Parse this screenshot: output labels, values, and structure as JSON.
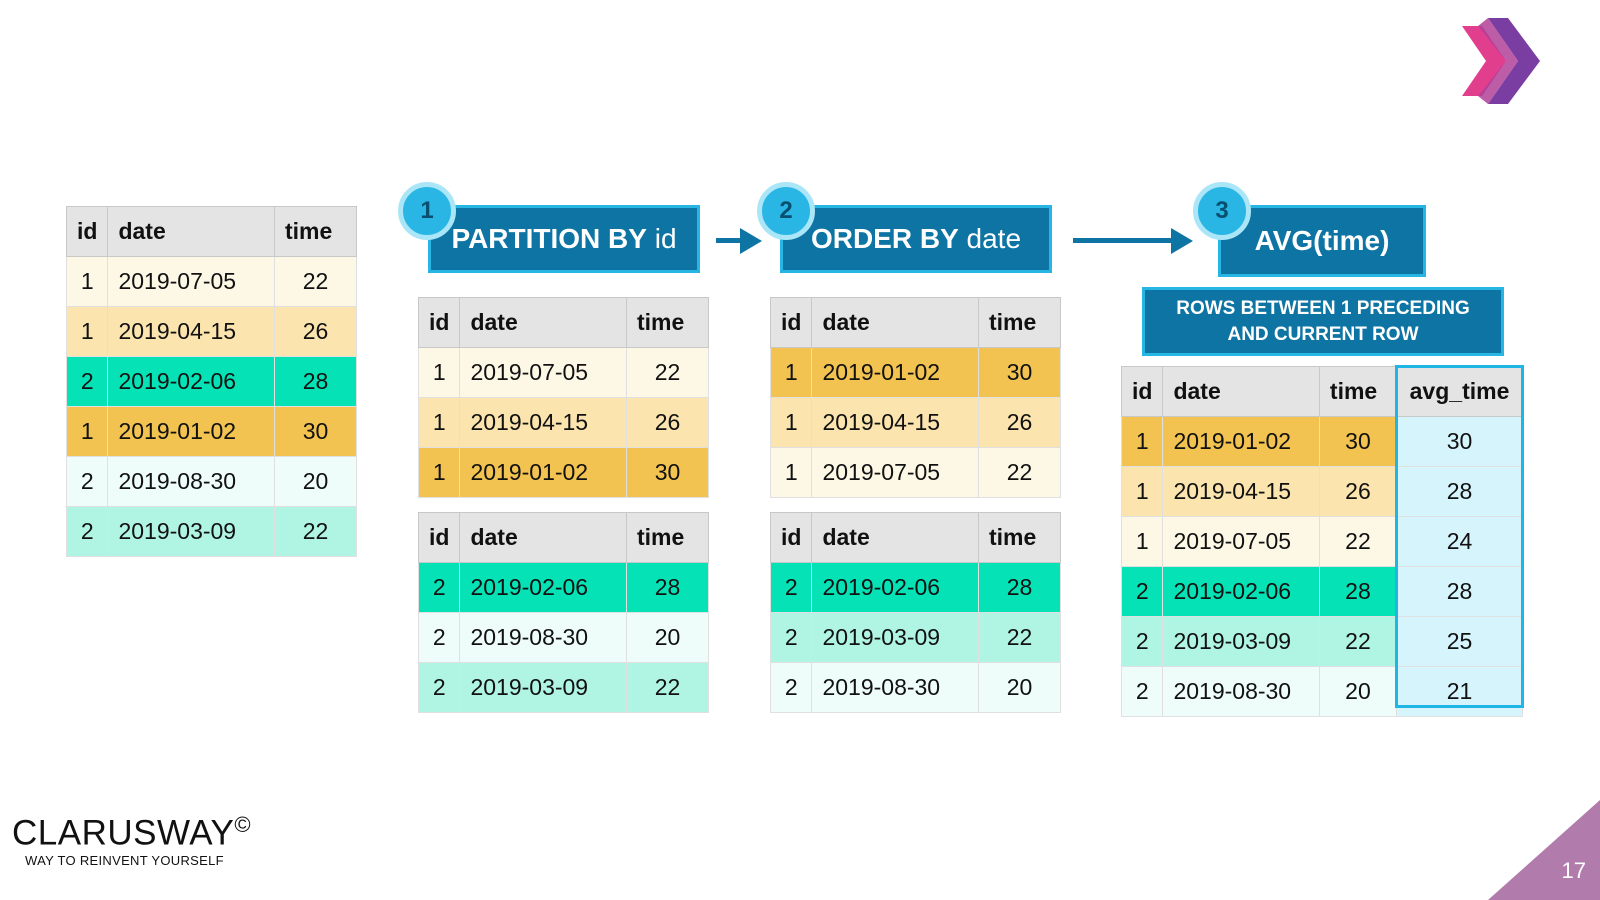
{
  "source_table": {
    "headers": [
      "id",
      "date",
      "time"
    ],
    "rows": [
      {
        "id": "1",
        "date": "2019-07-05",
        "time": "22",
        "shade": "y0"
      },
      {
        "id": "1",
        "date": "2019-04-15",
        "time": "26",
        "shade": "y1"
      },
      {
        "id": "2",
        "date": "2019-02-06",
        "time": "28",
        "shade": "g2"
      },
      {
        "id": "1",
        "date": "2019-01-02",
        "time": "30",
        "shade": "y2"
      },
      {
        "id": "2",
        "date": "2019-08-30",
        "time": "20",
        "shade": "g0"
      },
      {
        "id": "2",
        "date": "2019-03-09",
        "time": "22",
        "shade": "g1"
      }
    ]
  },
  "steps": [
    {
      "number": "1",
      "keyword": "PARTITION BY",
      "arg": "id"
    },
    {
      "number": "2",
      "keyword": "ORDER BY",
      "arg": "date"
    },
    {
      "number": "3",
      "keyword": "AVG(time)",
      "arg": ""
    }
  ],
  "frame_clause": {
    "line1": "ROWS BETWEEN 1 PRECEDING",
    "line2": "AND CURRENT ROW"
  },
  "partition_tables": [
    {
      "headers": [
        "id",
        "date",
        "time"
      ],
      "rows": [
        {
          "id": "1",
          "date": "2019-07-05",
          "time": "22",
          "shade": "y0"
        },
        {
          "id": "1",
          "date": "2019-04-15",
          "time": "26",
          "shade": "y1"
        },
        {
          "id": "1",
          "date": "2019-01-02",
          "time": "30",
          "shade": "y2"
        }
      ]
    },
    {
      "headers": [
        "id",
        "date",
        "time"
      ],
      "rows": [
        {
          "id": "2",
          "date": "2019-02-06",
          "time": "28",
          "shade": "g2"
        },
        {
          "id": "2",
          "date": "2019-08-30",
          "time": "20",
          "shade": "g0"
        },
        {
          "id": "2",
          "date": "2019-03-09",
          "time": "22",
          "shade": "g1"
        }
      ]
    }
  ],
  "ordered_tables": [
    {
      "headers": [
        "id",
        "date",
        "time"
      ],
      "rows": [
        {
          "id": "1",
          "date": "2019-01-02",
          "time": "30",
          "shade": "y2"
        },
        {
          "id": "1",
          "date": "2019-04-15",
          "time": "26",
          "shade": "y1"
        },
        {
          "id": "1",
          "date": "2019-07-05",
          "time": "22",
          "shade": "y0"
        }
      ]
    },
    {
      "headers": [
        "id",
        "date",
        "time"
      ],
      "rows": [
        {
          "id": "2",
          "date": "2019-02-06",
          "time": "28",
          "shade": "g2"
        },
        {
          "id": "2",
          "date": "2019-03-09",
          "time": "22",
          "shade": "g1"
        },
        {
          "id": "2",
          "date": "2019-08-30",
          "time": "20",
          "shade": "g0"
        }
      ]
    }
  ],
  "result_table": {
    "headers": [
      "id",
      "date",
      "time",
      "avg_time"
    ],
    "rows": [
      {
        "id": "1",
        "date": "2019-01-02",
        "time": "30",
        "avg_time": "30",
        "shade": "y2"
      },
      {
        "id": "1",
        "date": "2019-04-15",
        "time": "26",
        "avg_time": "28",
        "shade": "y1"
      },
      {
        "id": "1",
        "date": "2019-07-05",
        "time": "22",
        "avg_time": "24",
        "shade": "y0"
      },
      {
        "id": "2",
        "date": "2019-02-06",
        "time": "28",
        "avg_time": "28",
        "shade": "g2"
      },
      {
        "id": "2",
        "date": "2019-03-09",
        "time": "22",
        "avg_time": "25",
        "shade": "g1"
      },
      {
        "id": "2",
        "date": "2019-08-30",
        "time": "20",
        "avg_time": "21",
        "shade": "g0"
      }
    ]
  },
  "brand": {
    "name": "CLARUSWAY",
    "mark": "©",
    "tagline": "WAY TO REINVENT YOURSELF"
  },
  "page_number": "17",
  "colors": {
    "banner": "#0d74a3",
    "banner_border": "#27b6e4",
    "badge": "#2ab6e5",
    "corner": "#b17cab",
    "chevron_pink": "#e23e8e",
    "chevron_purple": "#6a3fa0"
  }
}
